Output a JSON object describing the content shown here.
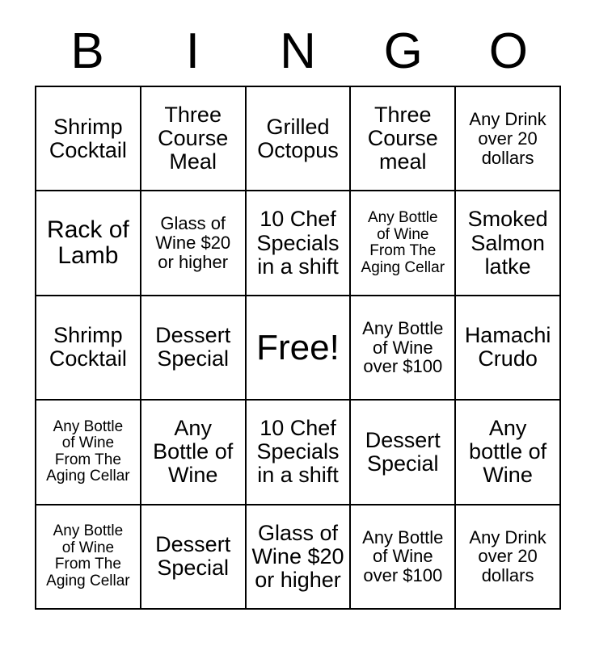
{
  "card": {
    "headers": [
      "B",
      "I",
      "N",
      "G",
      "O"
    ],
    "free_space_label": "Free!",
    "colors": {
      "border": "#000000",
      "text": "#000000",
      "background": "#ffffff"
    },
    "rows": [
      [
        {
          "text": "Shrimp\nCocktail",
          "size": "md"
        },
        {
          "text": "Three\nCourse\nMeal",
          "size": "md"
        },
        {
          "text": "Grilled\nOctopus",
          "size": "md"
        },
        {
          "text": "Three\nCourse\nmeal",
          "size": "md"
        },
        {
          "text": "Any Drink\nover 20\ndollars",
          "size": "sm"
        }
      ],
      [
        {
          "text": "Rack of\nLamb",
          "size": "lg"
        },
        {
          "text": "Glass of\nWine $20\nor higher",
          "size": "sm"
        },
        {
          "text": "10 Chef\nSpecials\nin a shift",
          "size": "md"
        },
        {
          "text": "Any Bottle\nof Wine\nFrom The\nAging Cellar",
          "size": "xs"
        },
        {
          "text": "Smoked\nSalmon\nlatke",
          "size": "md"
        }
      ],
      [
        {
          "text": "Shrimp\nCocktail",
          "size": "md"
        },
        {
          "text": "Dessert\nSpecial",
          "size": "md"
        },
        {
          "text": "Free!",
          "size": "free"
        },
        {
          "text": "Any Bottle\nof Wine\nover $100",
          "size": "sm"
        },
        {
          "text": "Hamachi\nCrudo",
          "size": "md"
        }
      ],
      [
        {
          "text": "Any Bottle\nof Wine\nFrom The\nAging Cellar",
          "size": "xs"
        },
        {
          "text": "Any\nBottle of\nWine",
          "size": "md"
        },
        {
          "text": "10 Chef\nSpecials\nin a shift",
          "size": "md"
        },
        {
          "text": "Dessert\nSpecial",
          "size": "md"
        },
        {
          "text": "Any\nbottle of\nWine",
          "size": "md"
        }
      ],
      [
        {
          "text": "Any Bottle\nof Wine\nFrom The\nAging Cellar",
          "size": "xs"
        },
        {
          "text": "Dessert\nSpecial",
          "size": "md"
        },
        {
          "text": "Glass of\nWine $20\nor higher",
          "size": "md"
        },
        {
          "text": "Any Bottle\nof Wine\nover $100",
          "size": "sm"
        },
        {
          "text": "Any Drink\nover 20\ndollars",
          "size": "sm"
        }
      ]
    ]
  }
}
